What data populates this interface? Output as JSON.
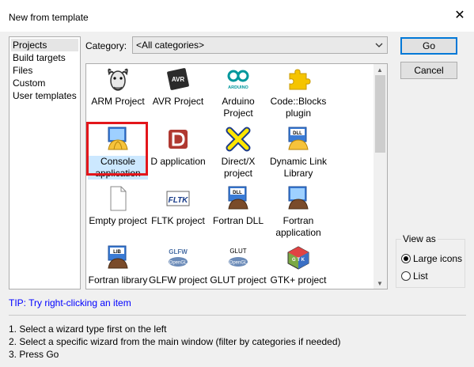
{
  "window": {
    "title": "New from template",
    "close_label": "✕"
  },
  "categories_list": [
    "Projects",
    "Build targets",
    "Files",
    "Custom",
    "User templates"
  ],
  "category_filter": {
    "label": "Category:",
    "value": "<All categories>"
  },
  "templates": [
    {
      "label": "ARM Project",
      "icon": "gnu-gnu-icon"
    },
    {
      "label": "AVR Project",
      "icon": "avr-chip-icon"
    },
    {
      "label": "Arduino Project",
      "icon": "arduino-icon"
    },
    {
      "label": "Code::Blocks plugin",
      "icon": "puzzle-piece-icon"
    },
    {
      "label": "Console application",
      "icon": "console-app-icon",
      "selected": true
    },
    {
      "label": "D application",
      "icon": "d-language-icon"
    },
    {
      "label": "Direct/X project",
      "icon": "directx-icon"
    },
    {
      "label": "Dynamic Link Library",
      "icon": "dll-icon"
    },
    {
      "label": "Empty project",
      "icon": "blank-page-icon"
    },
    {
      "label": "FLTK project",
      "icon": "fltk-icon"
    },
    {
      "label": "Fortran DLL",
      "icon": "fortran-dll-icon"
    },
    {
      "label": "Fortran application",
      "icon": "fortran-app-icon"
    },
    {
      "label": "Fortran library",
      "icon": "fortran-lib-icon"
    },
    {
      "label": "GLFW project",
      "icon": "glfw-icon"
    },
    {
      "label": "GLUT project",
      "icon": "glut-icon"
    },
    {
      "label": "GTK+ project",
      "icon": "gtk-icon"
    }
  ],
  "icon_text": {
    "avr": "AVR",
    "arduino": "ARDUINO",
    "dll": "DLL",
    "fltk": "FLTK",
    "lib": "LIB",
    "glfw": "GLFW",
    "opengl": "OpenGL",
    "glut": "GLUT",
    "gtk": "G T K"
  },
  "buttons": {
    "go": "Go",
    "cancel": "Cancel"
  },
  "view_as": {
    "legend": "View as",
    "options": [
      {
        "label": "Large icons",
        "checked": true
      },
      {
        "label": "List",
        "checked": false
      }
    ]
  },
  "tip": "TIP: Try right-clicking an item",
  "instructions": [
    "1. Select a wizard type first on the left",
    "2. Select a specific wizard from the main window (filter by categories if needed)",
    "3. Press Go"
  ],
  "colors": {
    "highlight_border": "#e3161b",
    "selection": "#cce8ff",
    "tip": "#0000ff",
    "default_button_border": "#0078d7"
  }
}
